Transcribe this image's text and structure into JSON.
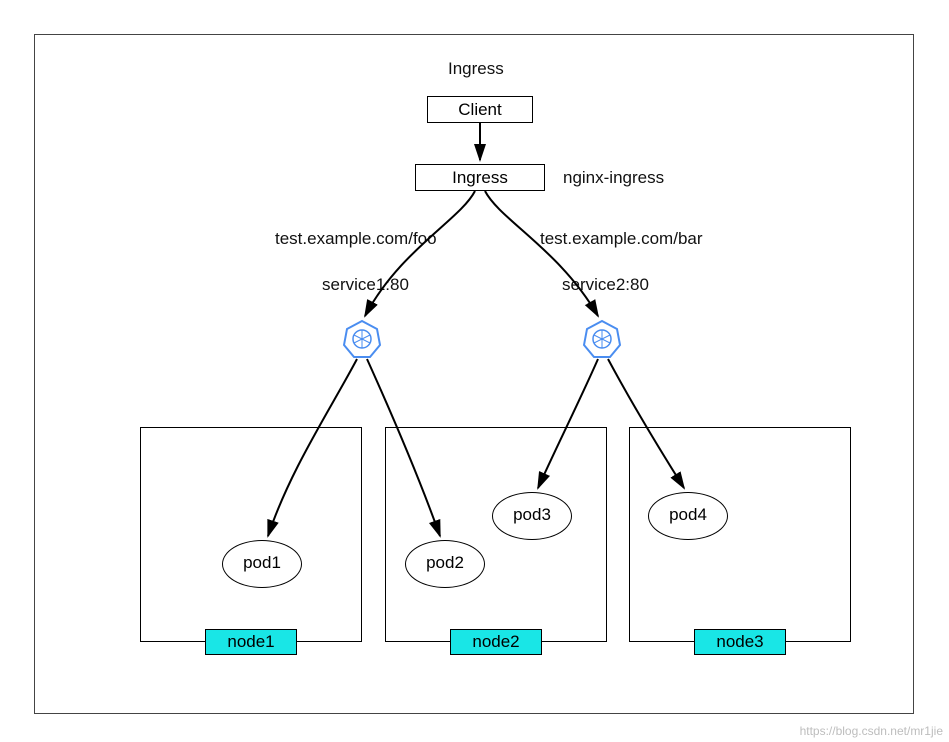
{
  "title": "Ingress",
  "client": "Client",
  "ingress": "Ingress",
  "ingress_annotation": "nginx-ingress",
  "routes": {
    "left": "test.example.com/foo",
    "right": "test.example.com/bar"
  },
  "services": {
    "left": "service1:80",
    "right": "service2:80"
  },
  "pods": {
    "p1": "pod1",
    "p2": "pod2",
    "p3": "pod3",
    "p4": "pod4"
  },
  "nodes": {
    "n1": "node1",
    "n2": "node2",
    "n3": "node3"
  },
  "watermark": "https://blog.csdn.net/mr1jie"
}
